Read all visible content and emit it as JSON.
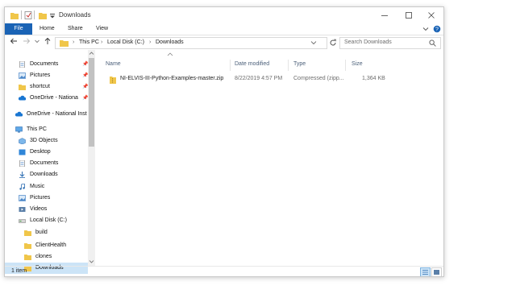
{
  "window": {
    "title": "Downloads"
  },
  "ribbon": {
    "tabs": [
      "File",
      "Home",
      "Share",
      "View"
    ]
  },
  "address": {
    "crumbs": [
      "This PC",
      "Local Disk (C:)",
      "Downloads"
    ]
  },
  "search": {
    "placeholder": "Search Downloads"
  },
  "nav": {
    "quick_access": [
      {
        "label": "Documents",
        "icon": "documents-icon",
        "pinned": true
      },
      {
        "label": "Pictures",
        "icon": "pictures-icon",
        "pinned": true
      },
      {
        "label": "shortcut",
        "icon": "folder-icon",
        "pinned": true
      },
      {
        "label": "OneDrive - Nationa",
        "icon": "onedrive-icon",
        "pinned": true
      }
    ],
    "onedrive": {
      "label": "OneDrive - National Inst"
    },
    "this_pc": {
      "label": "This PC"
    },
    "pc_items": [
      {
        "label": "3D Objects",
        "icon": "3d-objects-icon"
      },
      {
        "label": "Desktop",
        "icon": "desktop-icon"
      },
      {
        "label": "Documents",
        "icon": "documents-icon"
      },
      {
        "label": "Downloads",
        "icon": "downloads-icon"
      },
      {
        "label": "Music",
        "icon": "music-icon"
      },
      {
        "label": "Pictures",
        "icon": "pictures-icon"
      },
      {
        "label": "Videos",
        "icon": "videos-icon"
      },
      {
        "label": "Local Disk (C:)",
        "icon": "drive-icon"
      }
    ],
    "drive_folders": [
      {
        "label": "build",
        "selected": false
      },
      {
        "label": "ClientHealth",
        "selected": false
      },
      {
        "label": "clones",
        "selected": false
      },
      {
        "label": "Downloads",
        "selected": true
      }
    ]
  },
  "columns": {
    "name": "Name",
    "date": "Date modified",
    "type": "Type",
    "size": "Size"
  },
  "files": [
    {
      "name": "NI-ELVIS-III-Python-Examples-master.zip",
      "date": "8/22/2019 4:57 PM",
      "type": "Compressed (zipp...",
      "size": "1,364 KB"
    }
  ],
  "status": {
    "count": "1 item"
  },
  "colors": {
    "accent": "#1a63b5",
    "folder": "#f0c64a",
    "selection": "#cce4f7"
  }
}
